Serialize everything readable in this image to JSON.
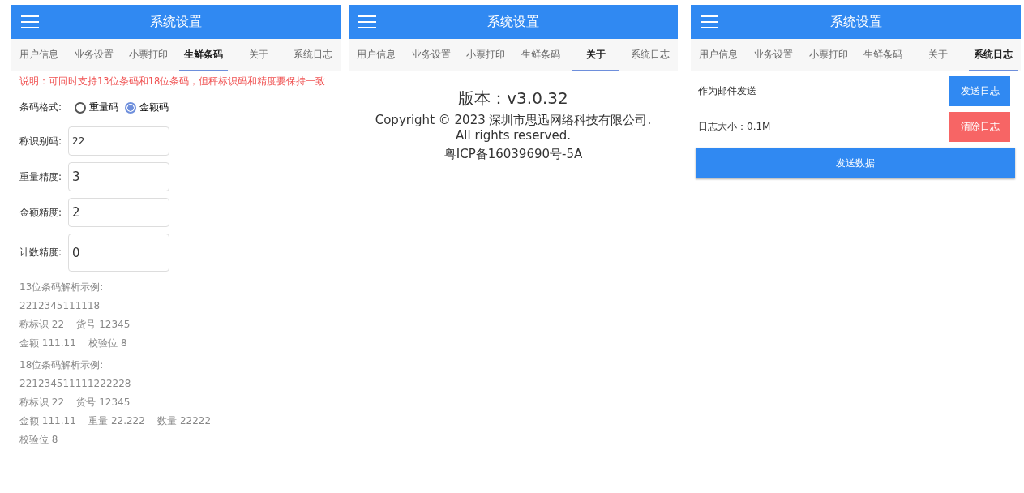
{
  "screens": [
    {
      "kind": "barcode",
      "title": "系统设置",
      "tabs": [
        {
          "label": "用户信息",
          "selected": false
        },
        {
          "label": "业务设置",
          "selected": false
        },
        {
          "label": "小票打印",
          "selected": false
        },
        {
          "label": "生鲜条码",
          "selected": true
        },
        {
          "label": "关于",
          "selected": false
        },
        {
          "label": "系统日志",
          "selected": false
        }
      ],
      "note": "说明：可同时支持13位条码和18位条码，但秤标识码和精度要保持一致",
      "format": {
        "label": "条码格式:",
        "options": [
          {
            "label": "重量码",
            "selected": false
          },
          {
            "label": "金额码",
            "selected": true
          }
        ]
      },
      "fields": [
        {
          "label": "称识别码:",
          "value": "22"
        },
        {
          "label": "重量精度:",
          "value": "3"
        },
        {
          "label": "金额精度:",
          "value": "2"
        },
        {
          "label": "计数精度:",
          "value": "0"
        }
      ],
      "examples": [
        [
          "13位条码解析示例:",
          "2212345111118",
          "称标识 22    货号 12345",
          "金额 111.11    校验位 8"
        ],
        [
          "18位条码解析示例:",
          "221234511111222228",
          "称标识 22    货号 12345",
          "金额 111.11    重量 22.222    数量 22222",
          "校验位 8"
        ]
      ]
    },
    {
      "kind": "about",
      "title": "系统设置",
      "tabs": [
        {
          "label": "用户信息",
          "selected": false
        },
        {
          "label": "业务设置",
          "selected": false
        },
        {
          "label": "小票打印",
          "selected": false
        },
        {
          "label": "生鲜条码",
          "selected": false
        },
        {
          "label": "关于",
          "selected": true
        },
        {
          "label": "系统日志",
          "selected": false
        }
      ],
      "version": "版本：v3.0.32",
      "copyright": [
        "Copyright © 2023 深圳市思迅网络科技有限公司.",
        "All rights reserved."
      ],
      "icp": "粤ICP备16039690号-5A"
    },
    {
      "kind": "log",
      "title": "系统设置",
      "tabs": [
        {
          "label": "用户信息",
          "selected": false
        },
        {
          "label": "业务设置",
          "selected": false
        },
        {
          "label": "小票打印",
          "selected": false
        },
        {
          "label": "生鲜条码",
          "selected": false
        },
        {
          "label": "关于",
          "selected": false
        },
        {
          "label": "系统日志",
          "selected": true
        }
      ],
      "rows": [
        {
          "label": "作为邮件发送",
          "button": "发送日志",
          "kind": "primary"
        },
        {
          "label": "日志大小：0.1M",
          "button": "清除日志",
          "kind": "danger"
        }
      ],
      "main_button": "发送数据"
    }
  ]
}
